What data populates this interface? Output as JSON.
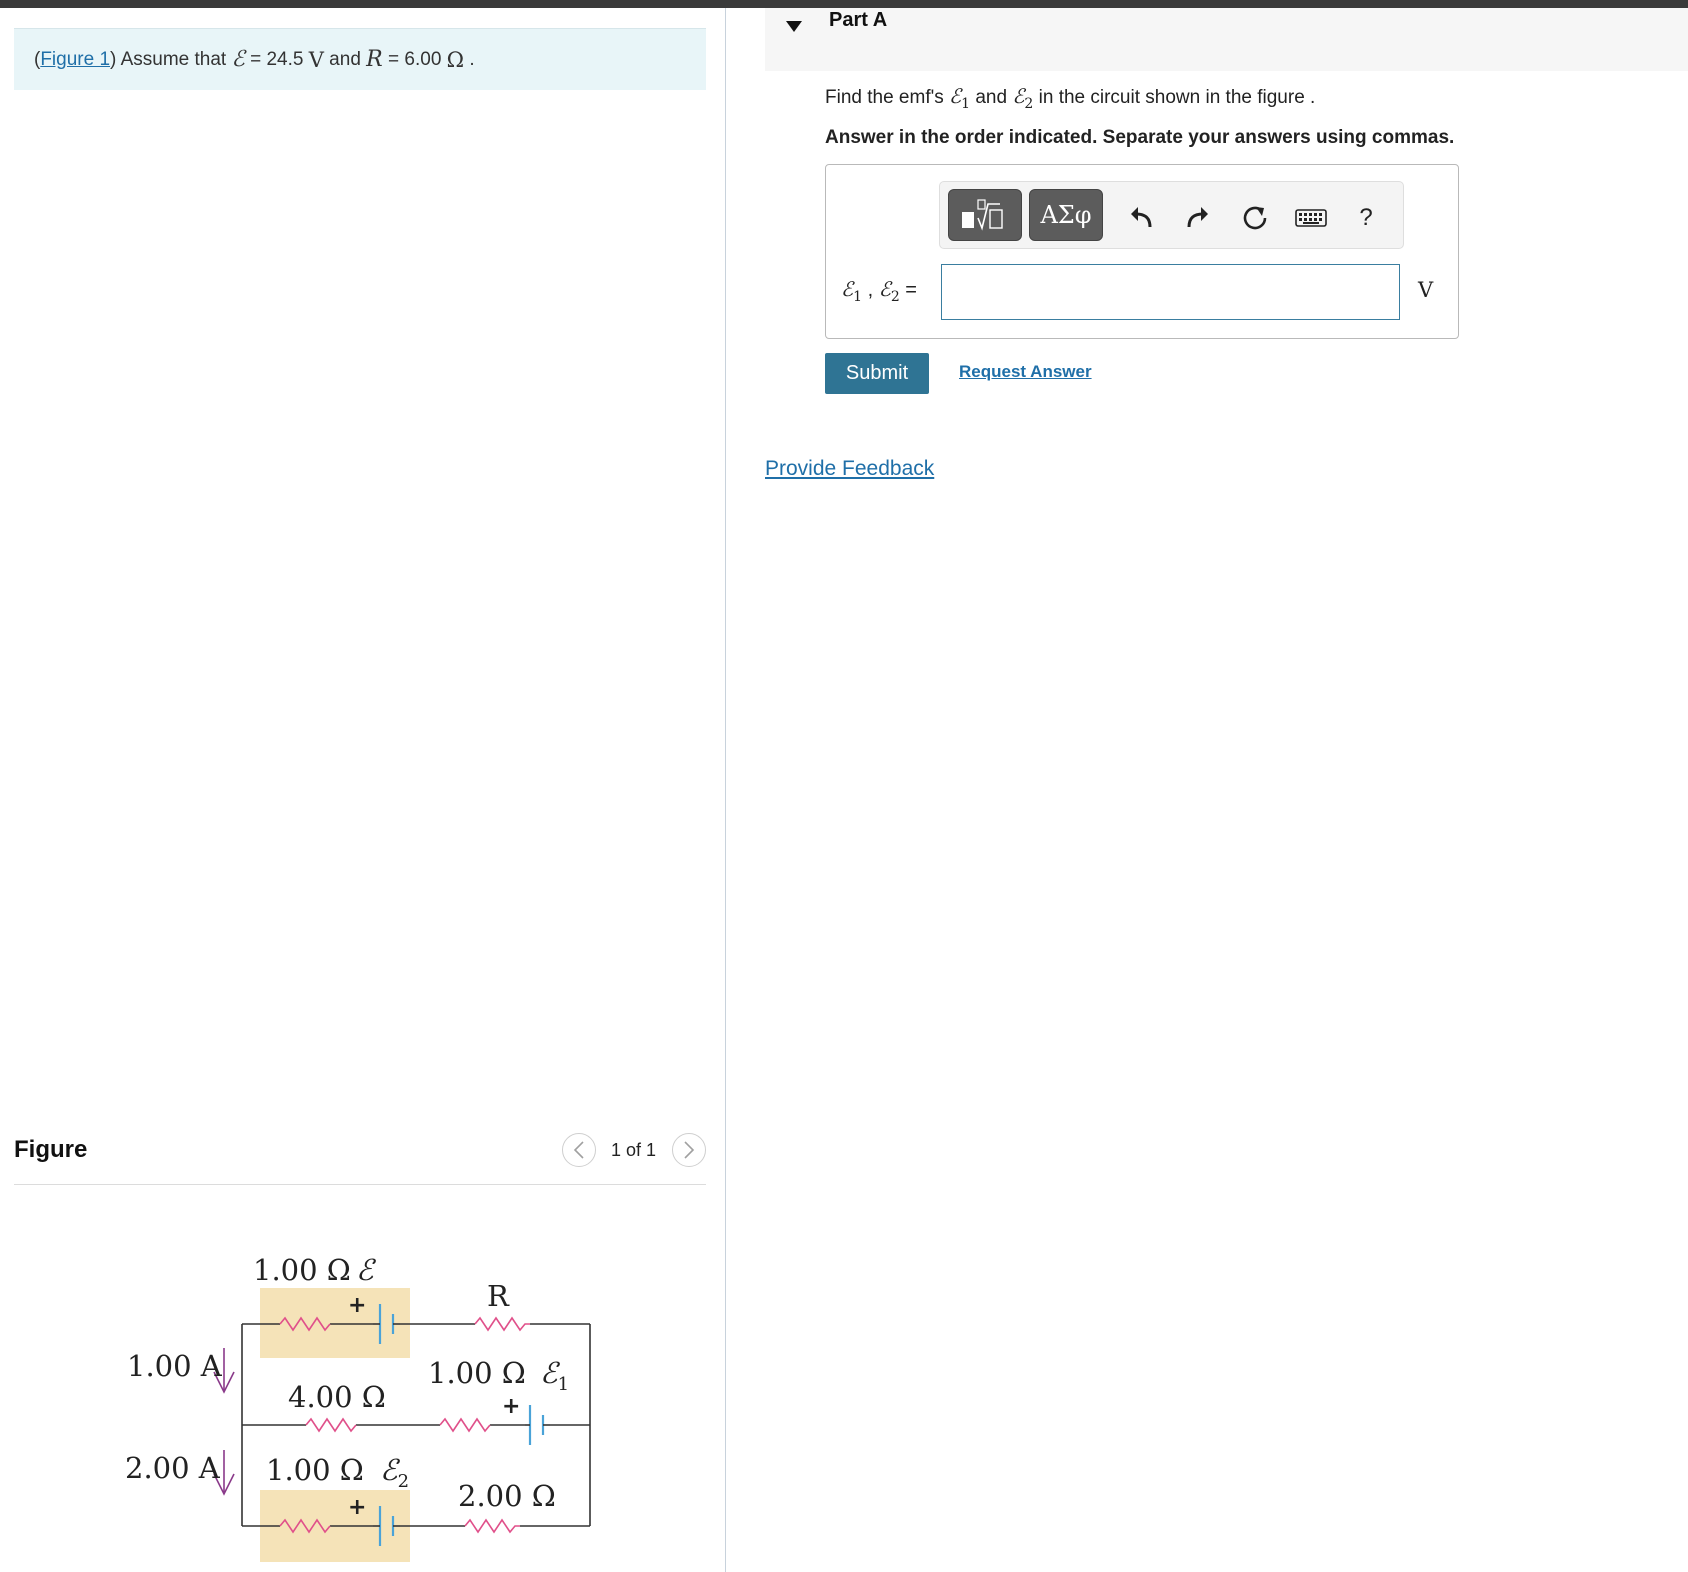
{
  "intro": {
    "prefix": "(",
    "figure_link": "Figure 1",
    "text_before": ") Assume that ",
    "emf_symbol": "ℰ",
    "eq1": " = 24.5 ",
    "unit_v": "V",
    "and": " and ",
    "r_symbol": "R",
    "eq2": " = 6.00 ",
    "unit_ohm": "Ω",
    "end": " ."
  },
  "figure": {
    "title": "Figure",
    "count": "1 of 1",
    "prev_icon": "chevron-left-icon",
    "next_icon": "chevron-right-icon",
    "labels": {
      "top_left_resistor": "1.00 Ω",
      "top_emf": "ℰ",
      "r": "R",
      "current_top": "1.00 A",
      "middle_left_resistor": "4.00 Ω",
      "middle_right_resistor": "1.00 Ω",
      "emf1_base": "ℰ",
      "emf1_sub": "1",
      "current_bottom": "2.00 A",
      "bottom_left_resistor": "1.00 Ω",
      "emf2_base": "ℰ",
      "emf2_sub": "2",
      "bottom_right_resistor": "2.00 Ω",
      "plus": "+"
    },
    "colors": {
      "resistor": "#e0508a",
      "battery": "#4aa3d8",
      "highlight": "#f5e3b8",
      "arrow": "#8a3a8a"
    }
  },
  "part": {
    "title": "Part A",
    "question_prefix": "Find the emf's ",
    "q_e1_base": "ℰ",
    "q_e1_sub": "1",
    "q_and": " and ",
    "q_e2_base": "ℰ",
    "q_e2_sub": "2",
    "question_suffix": " in the circuit shown in the figure .",
    "instruction": "Answer in the order indicated. Separate your answers using commas."
  },
  "toolbar": {
    "templates_icon": "templates-icon",
    "greek_label": "ΑΣφ",
    "undo_icon": "undo-icon",
    "redo_icon": "redo-icon",
    "reset_icon": "reset-icon",
    "keyboard_icon": "keyboard-icon",
    "help_label": "?"
  },
  "answer": {
    "e1_base": "ℰ",
    "e1_sub": "1",
    "sep": " , ",
    "e2_base": "ℰ",
    "e2_sub": "2",
    "equals": " =",
    "value": "",
    "unit": "V"
  },
  "actions": {
    "submit": "Submit",
    "request": "Request Answer",
    "feedback": "Provide Feedback"
  }
}
